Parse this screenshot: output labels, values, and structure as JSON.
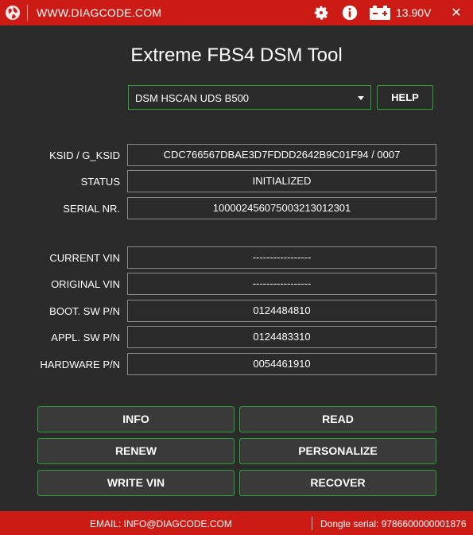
{
  "titlebar": {
    "website": "WWW.DIAGCODE.COM",
    "voltage": "13.90V",
    "close": "✕",
    "icons": [
      "globe-icon",
      "gear-icon",
      "info-icon",
      "battery-icon",
      "close-icon"
    ],
    "color": "#cc1b15"
  },
  "app": {
    "title": "Extreme FBS4 DSM Tool"
  },
  "adapter": {
    "selected": "DSM HSCAN UDS B500",
    "help_label": "HELP"
  },
  "fields": {
    "ksid": {
      "label": "KSID / G_KSID",
      "value": "CDC766567DBAE3D7FDDD2642B9C01F94 / 0007"
    },
    "status": {
      "label": "STATUS",
      "value": "INITIALIZED"
    },
    "serial": {
      "label": "SERIAL NR.",
      "value": "100002456075003213012301"
    },
    "current_vin": {
      "label": "CURRENT VIN",
      "value": "-----------------"
    },
    "original_vin": {
      "label": "ORIGINAL VIN",
      "value": "-----------------"
    },
    "boot_sw": {
      "label": "BOOT. SW P/N",
      "value": "0124484810"
    },
    "appl_sw": {
      "label": "APPL. SW P/N",
      "value": "0124483310"
    },
    "hardware": {
      "label": "HARDWARE P/N",
      "value": "0054461910"
    }
  },
  "buttons": {
    "info": "INFO",
    "read": "READ",
    "renew": "RENEW",
    "personalize": "PERSONALIZE",
    "write_vin": "WRITE VIN",
    "recover": "RECOVER"
  },
  "footer": {
    "email": "EMAIL: INFO@DIAGCODE.COM",
    "dongle": "Dongle serial: 9786600000001876"
  },
  "colors": {
    "accent": "#2ea335",
    "background": "#2b2b2b",
    "brand": "#cc1b15"
  }
}
